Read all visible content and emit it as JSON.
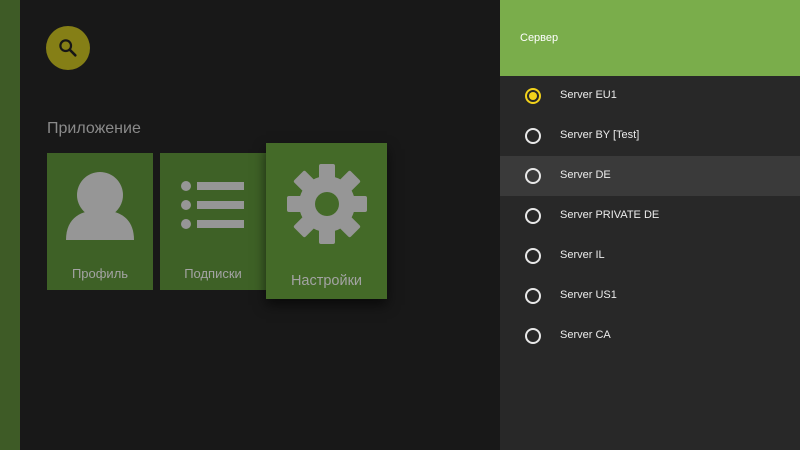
{
  "app": {
    "search_icon": "magnifier",
    "section_title": "Приложение"
  },
  "tiles": [
    {
      "label": "Профиль",
      "icon": "person-icon"
    },
    {
      "label": "Подписки",
      "icon": "list-icon"
    },
    {
      "label": "Настройки",
      "icon": "gear-icon"
    }
  ],
  "server_panel": {
    "title": "Сервер",
    "options": [
      {
        "label": "Server EU1",
        "selected": true
      },
      {
        "label": "Server BY [Test]",
        "selected": false
      },
      {
        "label": "Server DE",
        "selected": false,
        "focused": true
      },
      {
        "label": "Server PRIVATE DE",
        "selected": false
      },
      {
        "label": "Server IL",
        "selected": false
      },
      {
        "label": "Server US1",
        "selected": false
      },
      {
        "label": "Server CA",
        "selected": false
      }
    ]
  },
  "colors": {
    "accent_header": "#7aad4b",
    "tile_green": "#3e6126",
    "radio_selected": "#f2d21b",
    "search_button": "#857f16"
  }
}
